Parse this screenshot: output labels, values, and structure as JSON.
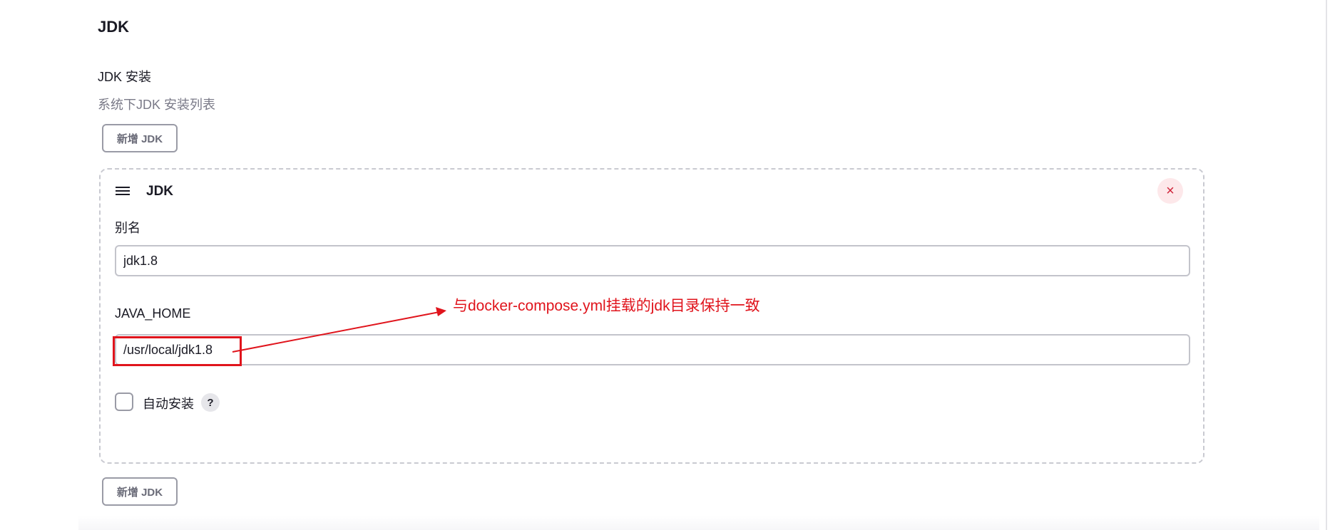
{
  "section": {
    "title": "JDK"
  },
  "jdk_installations": {
    "label": "JDK 安装",
    "description": "系统下JDK 安装列表",
    "add_button_label": "新增 JDK"
  },
  "jdk_item": {
    "title": "JDK",
    "close_icon": "close-icon",
    "close_symbol": "×",
    "alias_label": "别名",
    "alias_value": "jdk1.8",
    "java_home_label": "JAVA_HOME",
    "java_home_value": "/usr/local/jdk1.8",
    "auto_install_label": "自动安装",
    "auto_install_checked": false,
    "help_symbol": "?"
  },
  "annotation": {
    "text": "与docker-compose.yml挂载的jdk目录保持一致",
    "color": "#e0141c"
  },
  "colors": {
    "close_background": "#fde8ea",
    "close_foreground": "#d0243a",
    "muted_text": "#7a7a88"
  }
}
